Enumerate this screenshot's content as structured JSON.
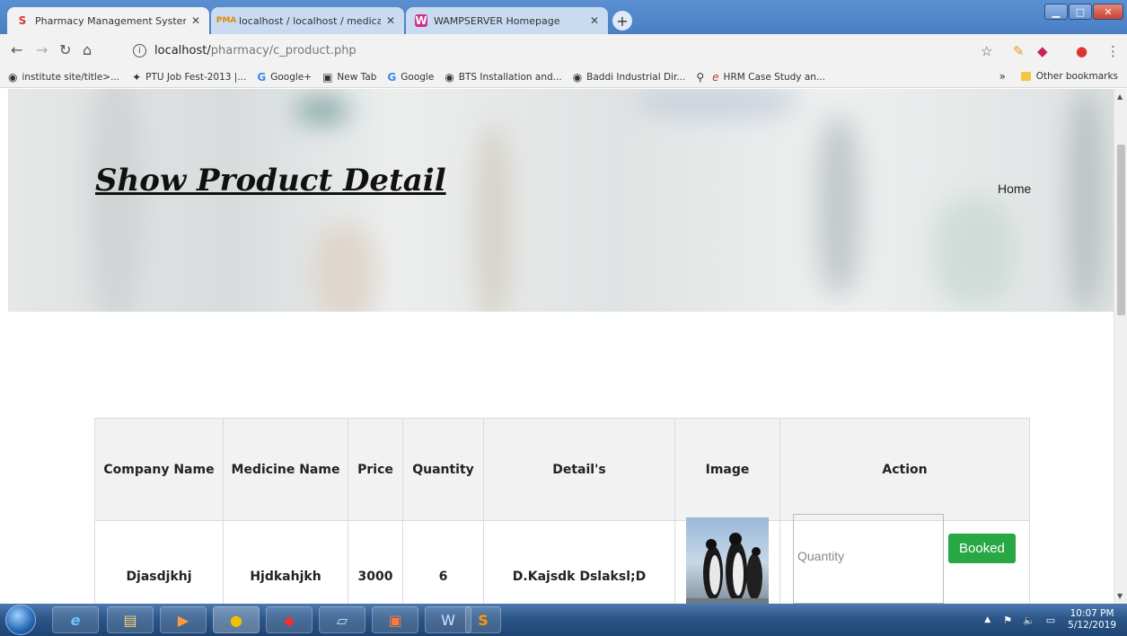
{
  "browser": {
    "tabs": [
      {
        "label": "Pharmacy Management System",
        "icon": "s-logo-icon",
        "active": true
      },
      {
        "label": "localhost / localhost / medical / ",
        "icon": "phpmyadmin-icon",
        "active": false
      },
      {
        "label": "WAMPSERVER Homepage",
        "icon": "wamp-icon",
        "active": false
      }
    ],
    "url_host": "localhost/",
    "url_path": "pharmacy/c_product.php",
    "bookmarks": [
      "institute site/title>...",
      "PTU Job Fest-2013 |...",
      "Google+",
      "New Tab",
      "Google",
      "BTS Installation and...",
      "Baddi Industrial Dir...",
      "",
      "HRM Case Study an..."
    ],
    "bookmarks_more": "»",
    "other_bookmarks": "Other bookmarks"
  },
  "page": {
    "hero_title": "Show Product Detail",
    "home_link": "Home",
    "table": {
      "headers": [
        "Company Name",
        "Medicine Name",
        "Price",
        "Quantity",
        "Detail's",
        "Image",
        "Action"
      ],
      "rows": [
        {
          "company": "Djasdjkhj",
          "medicine": "Hjdkahjkh",
          "price": "3000",
          "quantity": "6",
          "detail": "D.Kajsdk Dslaksl;D",
          "image": "penguins-image",
          "qty_placeholder": "Quantity",
          "action_label": "Booked"
        }
      ]
    }
  },
  "taskbar": {
    "time": "10:07 PM",
    "date": "5/12/2019"
  },
  "colors": {
    "booked_button": "#28a745",
    "taskbar": "#2c5688"
  }
}
